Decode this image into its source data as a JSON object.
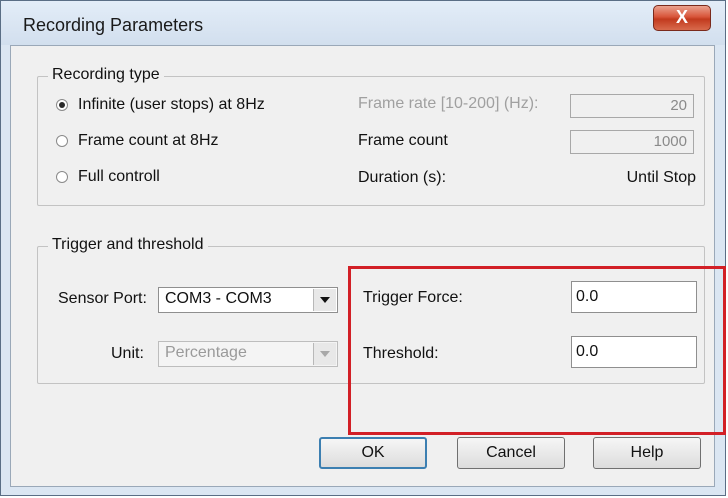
{
  "window": {
    "title": "Recording Parameters",
    "close_label": "X"
  },
  "recording_type": {
    "label": "Recording type",
    "options": [
      {
        "label": "Infinite (user stops) at 8Hz",
        "checked": true
      },
      {
        "label": "Frame count at 8Hz",
        "checked": false
      },
      {
        "label": "Full controll",
        "checked": false
      }
    ],
    "frame_rate": {
      "label": "Frame rate [10-200] (Hz):",
      "value": "20"
    },
    "frame_count": {
      "label": "Frame count",
      "value": "1000"
    },
    "duration": {
      "label": "Duration (s):",
      "value": "Until Stop"
    }
  },
  "trigger": {
    "label": "Trigger and threshold",
    "sensor_port": {
      "label": "Sensor Port:",
      "value": "COM3 - COM3"
    },
    "unit": {
      "label": "Unit:",
      "value": "Percentage"
    },
    "trigger_force": {
      "label": "Trigger Force:",
      "value": "0.0"
    },
    "threshold": {
      "label": "Threshold:",
      "value": "0.0"
    }
  },
  "buttons": {
    "ok": "OK",
    "cancel": "Cancel",
    "help": "Help"
  },
  "colors": {
    "highlight": "#d21f26",
    "titlebar": "#dbe6f2",
    "close_button": "#c23a1e"
  },
  "icons": {
    "close": "close-icon",
    "dropdown": "chevron-down-icon"
  }
}
